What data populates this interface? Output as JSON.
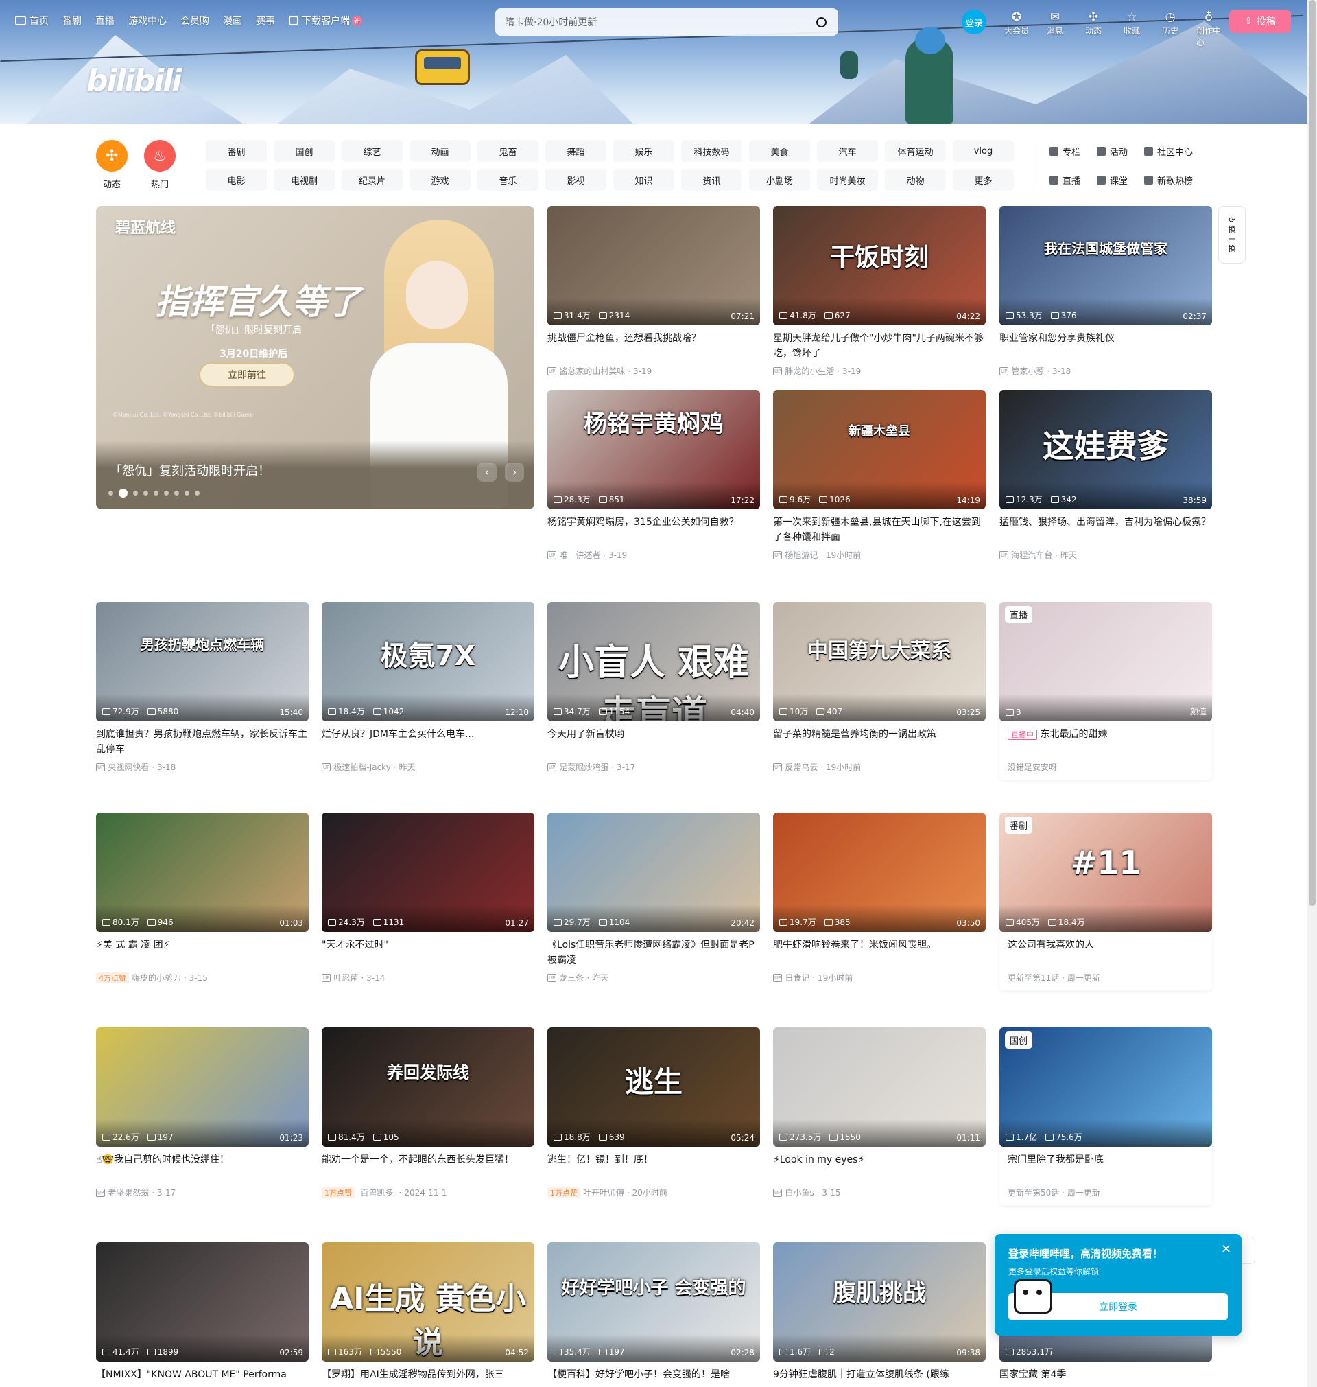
{
  "topnav": {
    "items": [
      "首页",
      "番剧",
      "直播",
      "游戏中心",
      "会员购",
      "漫画",
      "赛事",
      "下载客户端"
    ],
    "new_badge": "新"
  },
  "logo": "bilibili",
  "search": {
    "placeholder": "隋卡做·20小时前更新"
  },
  "rightnav": {
    "login": "登录",
    "items": [
      "大会员",
      "消息",
      "动态",
      "收藏",
      "历史",
      "创作中心"
    ],
    "upload": "投稿"
  },
  "quick": {
    "dynamic": "动态",
    "hot": "热门"
  },
  "channels": [
    "番剧",
    "国创",
    "综艺",
    "动画",
    "鬼畜",
    "舞蹈",
    "娱乐",
    "科技数码",
    "美食",
    "汽车",
    "体育运动",
    "vlog",
    "电影",
    "电视剧",
    "纪录片",
    "游戏",
    "音乐",
    "影视",
    "知识",
    "资讯",
    "小剧场",
    "时尚美妆",
    "动物",
    "更多"
  ],
  "tools": [
    "专栏",
    "活动",
    "社区中心",
    "直播",
    "课堂",
    "新歌热榜"
  ],
  "carousel": {
    "brand": "碧蓝航线",
    "headline": "指挥官久等了",
    "sub": "「怨仇」限时复刻开启",
    "date": "3月20日维护后",
    "cta": "立即前往",
    "fine": "©Manjuu Co.,Ltd. ©Yongshi Co.,Ltd. ©bilibili Game",
    "title": "「怨仇」复刻活动限时开启！"
  },
  "refresh": [
    "换",
    "一",
    "换"
  ],
  "cards": [
    {
      "title": "挑战僵尸金枪鱼，还想看我挑战啥？",
      "views": "31.4万",
      "danmaku": "2314",
      "dur": "07:21",
      "author": "酱总家的山村美味",
      "date": "3-19",
      "overlay": ""
    },
    {
      "title": "星期天胖龙给儿子做个\"小炒牛肉\"儿子两碗米不够吃，馋坏了",
      "views": "41.8万",
      "danmaku": "627",
      "dur": "04:22",
      "author": "胖龙的小生活",
      "date": "3-19",
      "overlay": "干饭时刻"
    },
    {
      "title": "职业管家和您分享贵族礼仪",
      "views": "53.3万",
      "danmaku": "376",
      "dur": "02:37",
      "author": "管家小葱",
      "date": "3-18",
      "overlay": "我在法国城堡做管家"
    },
    {
      "title": "杨铭宇黄焖鸡塌房，315企业公关如何自救？",
      "views": "28.3万",
      "danmaku": "851",
      "dur": "17:22",
      "author": "唯一讲述者",
      "date": "3-19",
      "overlay": "杨铭宇黄焖鸡"
    },
    {
      "title": "第一次来到新疆木垒县,县城在天山脚下,在这尝到了各种馕和拌面",
      "views": "9.6万",
      "danmaku": "1026",
      "dur": "14:19",
      "author": "杨旭游记",
      "date": "19小时前",
      "overlay": "新疆木垒县"
    },
    {
      "title": "猛砸钱、狠择场、出海留洋，吉利为啥偏心极氪？",
      "views": "12.3万",
      "danmaku": "342",
      "dur": "38:59",
      "author": "海狸汽车台",
      "date": "昨天",
      "overlay": "这娃费爹"
    },
    {
      "title": "到底谁担责？男孩扔鞭炮点燃车辆，家长反诉车主乱停车",
      "views": "72.9万",
      "danmaku": "5880",
      "dur": "15:40",
      "author": "央视网快看",
      "date": "3-18",
      "overlay": "男孩扔鞭炮点燃车辆"
    },
    {
      "title": "烂仔从良？JDM车主会买什么电车...",
      "views": "18.4万",
      "danmaku": "1042",
      "dur": "12:10",
      "author": "极速拍档-Jacky",
      "date": "昨天",
      "overlay": "极氪7X"
    },
    {
      "title": "今天用了新盲杖哟",
      "views": "34.7万",
      "danmaku": "1154",
      "dur": "04:40",
      "author": "是蒙眼炒鸡蛋",
      "date": "3-17",
      "overlay": "小盲人 艰难走盲道"
    },
    {
      "title": "留子菜的精髓是营养均衡的一锅出政策",
      "views": "10万",
      "danmaku": "407",
      "dur": "03:25",
      "author": "反常乌云",
      "date": "19小时前",
      "overlay": "中国第九大菜系"
    },
    {
      "title": "东北最后的甜妹",
      "views": "3",
      "danmaku": "",
      "dur": "颜值",
      "author": "没错是安安呀",
      "date": "",
      "overlay": "",
      "tag": "直播",
      "badge": "直播中"
    },
    {
      "title": "⚡美 式 霸 凌 团⚡",
      "views": "80.1万",
      "danmaku": "946",
      "dur": "01:03",
      "author": "嗨皮的小剪刀",
      "date": "3-15",
      "overlay": "",
      "hot": "4万点赞"
    },
    {
      "title": "\"天才永不过时\"",
      "views": "24.3万",
      "danmaku": "1131",
      "dur": "01:27",
      "author": "叶忍菌",
      "date": "3-14",
      "overlay": ""
    },
    {
      "title": "《Lois任职音乐老师惨遭网络霸凌》但封面是老P被霸凌",
      "views": "29.7万",
      "danmaku": "1104",
      "dur": "20:42",
      "author": "龙三条",
      "date": "昨天",
      "overlay": ""
    },
    {
      "title": "肥牛虾滑响铃卷来了！米饭闻风丧胆。",
      "views": "19.7万",
      "danmaku": "385",
      "dur": "03:50",
      "author": "日食记",
      "date": "19小时前",
      "overlay": ""
    },
    {
      "title": "这公司有我喜欢的人",
      "views": "405万",
      "danmaku": "18.4万",
      "dur": "",
      "author": "更新至第11话",
      "date": "周一更新",
      "overlay": "#11",
      "tag": "番剧"
    },
    {
      "title": "☝🤓我自己剪的时候也没绷住！",
      "views": "22.6万",
      "danmaku": "197",
      "dur": "01:23",
      "author": "老坚果然翁",
      "date": "3-17",
      "overlay": ""
    },
    {
      "title": "能劝一个是一个，不起眼的东西长头发巨猛！",
      "views": "81.4万",
      "danmaku": "105",
      "dur": "",
      "author": "-百兽凯多-",
      "date": "2024-11-1",
      "overlay": "养回发际线",
      "hot": "1万点赞"
    },
    {
      "title": "逃生！亿！镜！到！底！",
      "views": "18.8万",
      "danmaku": "639",
      "dur": "05:24",
      "author": "叶开叶师傅",
      "date": "20小时前",
      "overlay": "逃生",
      "hot": "1万点赞"
    },
    {
      "title": "⚡Look in my eyes⚡",
      "views": "273.5万",
      "danmaku": "1550",
      "dur": "01:11",
      "author": "白小鱼s",
      "date": "3-15",
      "overlay": ""
    },
    {
      "title": "宗门里除了我都是卧底",
      "views": "1.7亿",
      "danmaku": "75.6万",
      "dur": "",
      "author": "更新至第50话",
      "date": "周一更新",
      "overlay": "",
      "tag": "国创"
    },
    {
      "title": "【NMIXX】\"KNOW ABOUT ME\" Performa",
      "views": "41.4万",
      "danmaku": "1899",
      "dur": "02:59",
      "author": "",
      "date": "",
      "overlay": ""
    },
    {
      "title": "【罗翔】用AI生成淫秽物品传到外网，张三",
      "views": "163万",
      "danmaku": "5550",
      "dur": "04:52",
      "author": "",
      "date": "",
      "overlay": "AI生成 黄色小说"
    },
    {
      "title": "【梗百科】好好学吧小子！会变强的！是啥",
      "views": "35.4万",
      "danmaku": "197",
      "dur": "02:28",
      "author": "",
      "date": "",
      "overlay": "好好学吧小子 会变强的"
    },
    {
      "title": "9分钟狂虐腹肌｜打造立体腹肌线条 (跟练",
      "views": "1.6万",
      "danmaku": "2",
      "dur": "09:38",
      "author": "",
      "date": "",
      "overlay": "腹肌挑战"
    },
    {
      "title": "国家宝藏 第4季",
      "views": "2853.1万",
      "danmaku": "",
      "dur": "",
      "author": "",
      "date": "",
      "overlay": ""
    }
  ],
  "popup": {
    "title": "登录哔哩哔哩，高清视频免费看！",
    "subtitle": "更多登录后权益等你解锁",
    "button": "立即登录"
  },
  "colors": {
    "pink": "#fb7299",
    "blue": "#00aeec",
    "orange": "#ff7f24",
    "popup": "#00a1d6"
  }
}
